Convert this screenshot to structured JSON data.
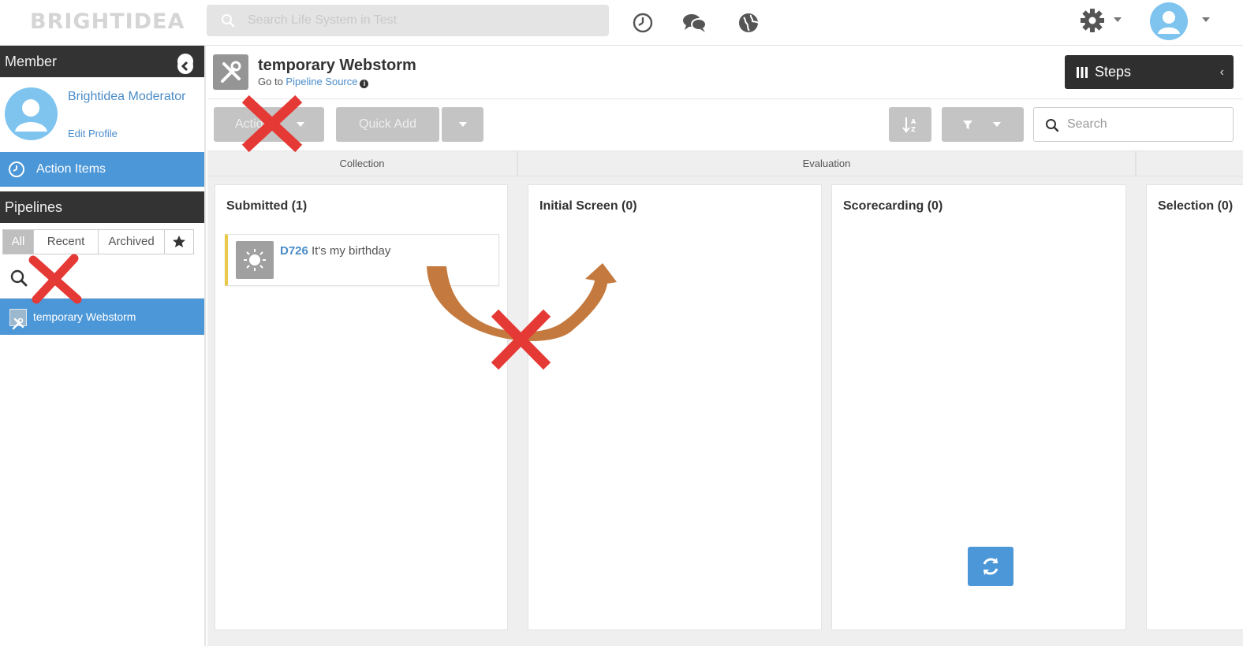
{
  "app": {
    "logo_text": "BRIGHTIDEA"
  },
  "header": {
    "search_placeholder": "Search Life System in Test",
    "icons": [
      "clock-icon",
      "chat-icon",
      "globe-icon",
      "gear-icon",
      "avatar",
      "chevron-down-icon"
    ]
  },
  "sidebar": {
    "member_title": "Member",
    "member_name": "Brightidea Moderator",
    "edit_profile": "Edit Profile",
    "action_items": "Action Items",
    "pipelines_title": "Pipelines",
    "filter_tabs": [
      "All",
      "Recent",
      "Archived"
    ],
    "pipeline_items": [
      "temporary Webstorm"
    ]
  },
  "pipeline": {
    "title": "temporary Webstorm",
    "goto_prefix": "Go to",
    "goto_link": "Pipeline Source",
    "steps_label": "Steps"
  },
  "toolbar": {
    "actions_label": "Actions",
    "quick_add_label": "Quick Add",
    "search_placeholder": "Search"
  },
  "board": {
    "stages": [
      "Collection",
      "Evaluation"
    ],
    "columns": [
      {
        "title": "Submitted",
        "count": "(1)"
      },
      {
        "title": "Initial Screen",
        "count": "(0)"
      },
      {
        "title": "Scorecarding",
        "count": "(0)"
      },
      {
        "title": "Selection",
        "count": "(0)"
      }
    ],
    "cards": [
      {
        "id": "D726",
        "title": "It's my birthday"
      }
    ]
  },
  "colors": {
    "accent_blue": "#4b97d8",
    "dark_header": "#333333",
    "annotation_red": "#e53935",
    "annotation_arrow": "#c0723a"
  }
}
